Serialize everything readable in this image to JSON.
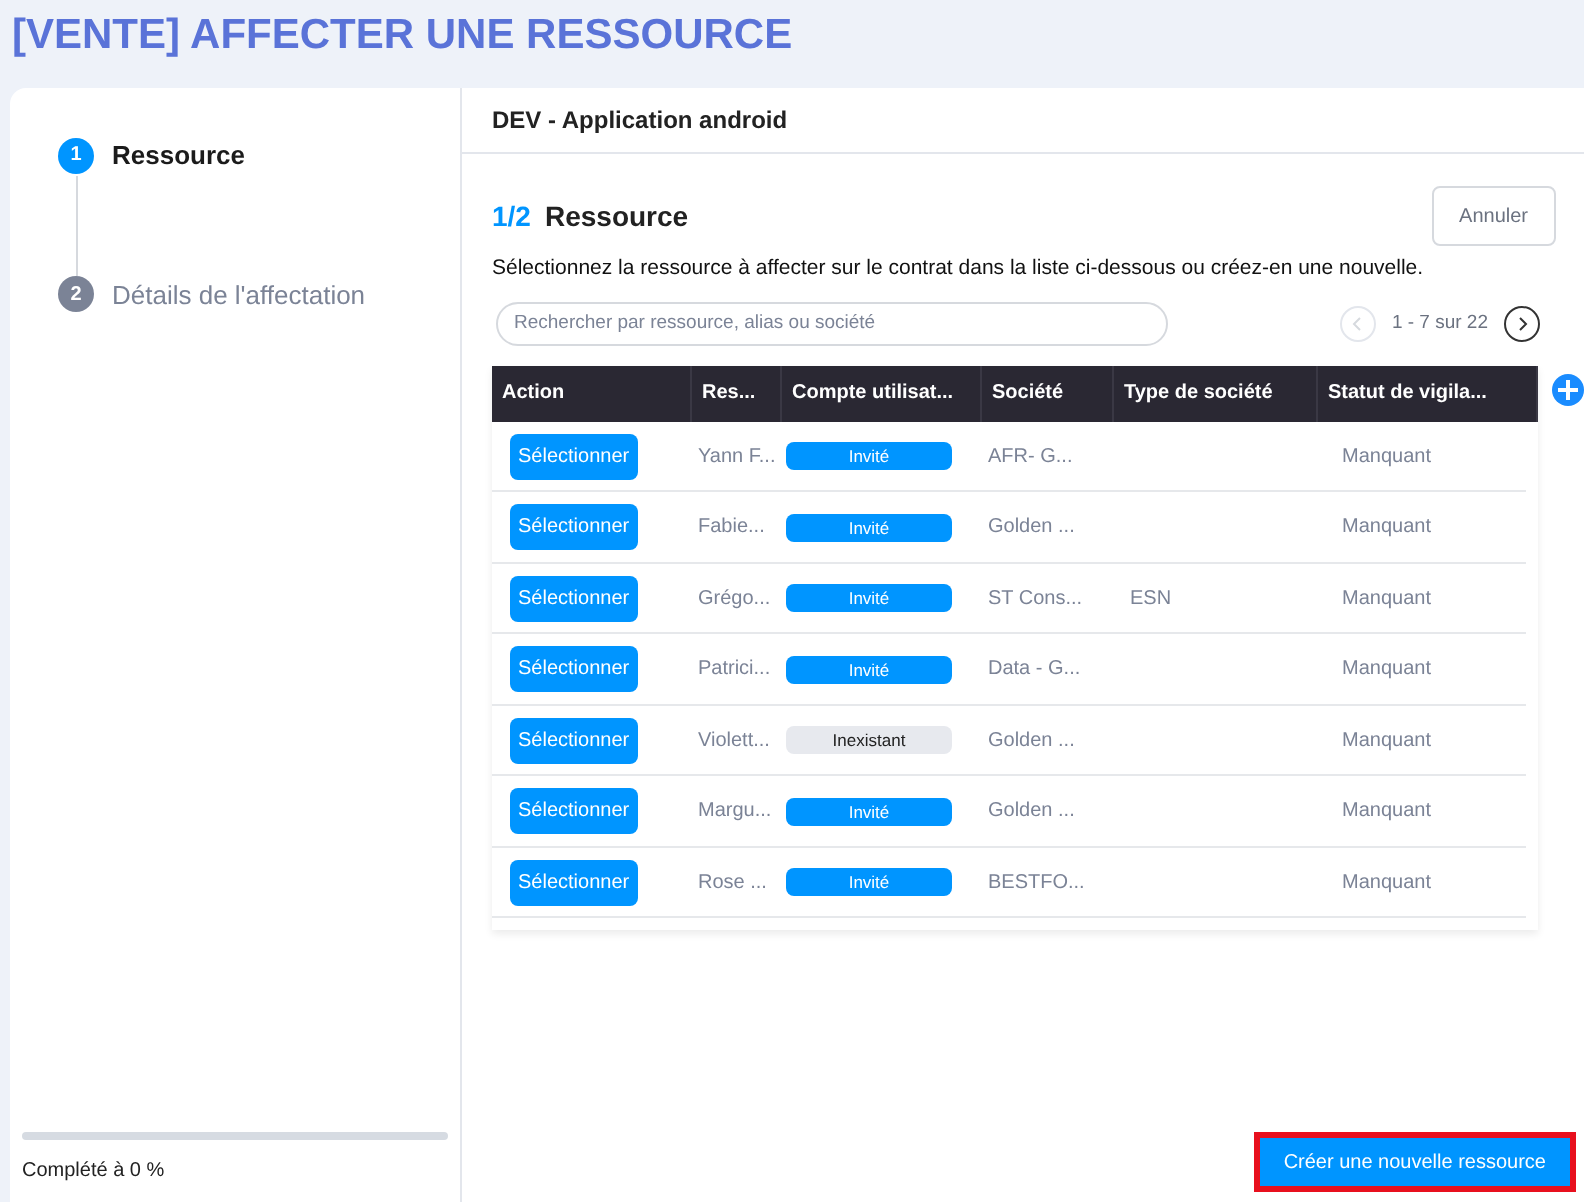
{
  "page_title": "[VENTE] AFFECTER UNE RESSOURCE",
  "steps": [
    {
      "number": "1",
      "label": "Ressource",
      "selected": true
    },
    {
      "number": "2",
      "label": "Détails de l'affectation",
      "selected": false
    }
  ],
  "progress": {
    "level": 0,
    "label": "Complété à 0 %"
  },
  "contract_title": "DEV - Application android",
  "section": {
    "step": "1/2",
    "title": "Ressource"
  },
  "cancel_button": "Annuler",
  "instructions": "Sélectionnez la ressource à affecter sur le contrat dans la liste ci-dessous ou créez-en une nouvelle.",
  "search": {
    "placeholder": "Rechercher par ressource, alias ou société"
  },
  "pagination": {
    "range": "1 - 7 sur 22",
    "prev_disabled": true
  },
  "table": {
    "columns": [
      "Action",
      "Res...",
      "Compte utilisat...",
      "Société",
      "Type de société",
      "Statut de vigila..."
    ],
    "rows": [
      {
        "action": "Sélectionner",
        "resource": "Yann F...",
        "account": {
          "label": "Invité",
          "kind": "invited"
        },
        "company": "AFR- G...",
        "company_type": "",
        "status": "Manquant"
      },
      {
        "action": "Sélectionner",
        "resource": "Fabie...",
        "account": {
          "label": "Invité",
          "kind": "invited"
        },
        "company": "Golden ...",
        "company_type": "",
        "status": "Manquant"
      },
      {
        "action": "Sélectionner",
        "resource": "Grégo...",
        "account": {
          "label": "Invité",
          "kind": "invited"
        },
        "company": "ST Cons...",
        "company_type": "ESN",
        "status": "Manquant"
      },
      {
        "action": "Sélectionner",
        "resource": "Patrici...",
        "account": {
          "label": "Invité",
          "kind": "invited"
        },
        "company": "Data - G...",
        "company_type": "",
        "status": "Manquant"
      },
      {
        "action": "Sélectionner",
        "resource": "Violett...",
        "account": {
          "label": "Inexistant",
          "kind": "none"
        },
        "company": "Golden ...",
        "company_type": "",
        "status": "Manquant"
      },
      {
        "action": "Sélectionner",
        "resource": "Margu...",
        "account": {
          "label": "Invité",
          "kind": "invited"
        },
        "company": "Golden ...",
        "company_type": "",
        "status": "Manquant"
      },
      {
        "action": "Sélectionner",
        "resource": "Rose ...",
        "account": {
          "label": "Invité",
          "kind": "invited"
        },
        "company": "BESTFO...",
        "company_type": "",
        "status": "Manquant"
      }
    ]
  },
  "create_button": {
    "label": "Créer une nouvelle ressource",
    "highlighted": true
  }
}
